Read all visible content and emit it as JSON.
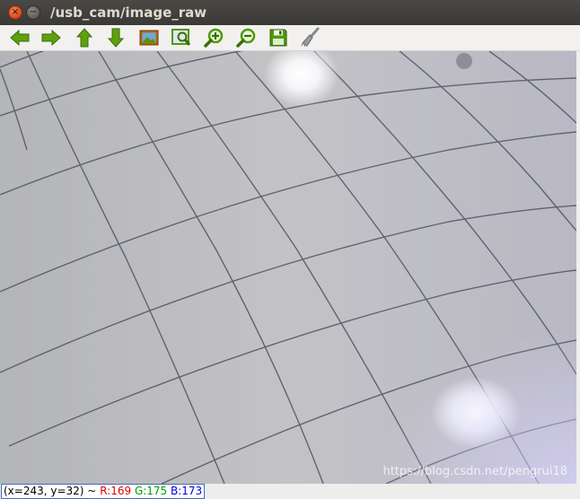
{
  "window": {
    "title": "/usb_cam/image_raw",
    "close_glyph": "×",
    "minimize_glyph": "−"
  },
  "toolbar": {
    "buttons": [
      {
        "name": "back",
        "icon": "arrow-left-icon"
      },
      {
        "name": "forward",
        "icon": "arrow-right-icon"
      },
      {
        "name": "up",
        "icon": "arrow-up-icon"
      },
      {
        "name": "down",
        "icon": "arrow-down-icon"
      },
      {
        "name": "reset-view",
        "icon": "picture-icon"
      },
      {
        "name": "zoom-to-region",
        "icon": "zoom-region-icon"
      },
      {
        "name": "zoom-in",
        "icon": "zoom-in-icon"
      },
      {
        "name": "zoom-out",
        "icon": "zoom-out-icon"
      },
      {
        "name": "save",
        "icon": "floppy-disk-icon"
      },
      {
        "name": "edit",
        "icon": "brush-icon"
      }
    ]
  },
  "image": {
    "background": "#bcbcbf",
    "grid_line_color": "#4f5463"
  },
  "status": {
    "coords": "(x=243, y=32) ~",
    "r": "R:169",
    "g": "G:175",
    "b": "B:173"
  },
  "watermark": "https://blog.csdn.net/pengrui18",
  "colors": {
    "titlebar": "#3c3b37",
    "close": "#dd4814",
    "toolbar_green": "#4e9a06"
  }
}
